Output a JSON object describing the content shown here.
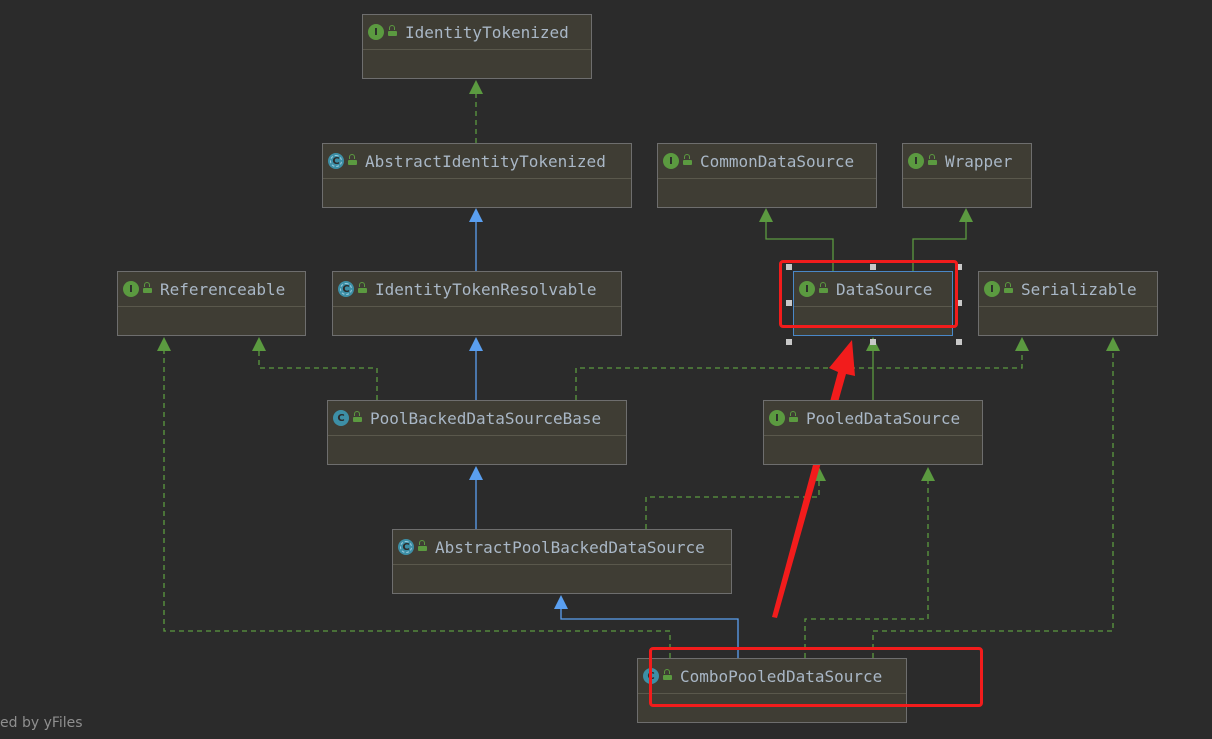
{
  "nodes": {
    "identity_tokenized": {
      "name": "IdentityTokenized",
      "kind": "interface"
    },
    "abstract_identity_tokenized": {
      "name": "AbstractIdentityTokenized",
      "kind": "abstract"
    },
    "common_data_source": {
      "name": "CommonDataSource",
      "kind": "interface"
    },
    "wrapper": {
      "name": "Wrapper",
      "kind": "interface"
    },
    "referenceable": {
      "name": "Referenceable",
      "kind": "interface"
    },
    "identity_token_resolvable": {
      "name": "IdentityTokenResolvable",
      "kind": "abstract"
    },
    "data_source": {
      "name": "DataSource",
      "kind": "interface"
    },
    "serializable": {
      "name": "Serializable",
      "kind": "interface"
    },
    "pool_backed_data_source_base": {
      "name": "PoolBackedDataSourceBase",
      "kind": "class"
    },
    "pooled_data_source": {
      "name": "PooledDataSource",
      "kind": "interface"
    },
    "abstract_pool_backed_data_source": {
      "name": "AbstractPoolBackedDataSource",
      "kind": "abstract"
    },
    "combo_pooled_data_source": {
      "name": "ComboPooledDataSource",
      "kind": "class"
    }
  },
  "kind_letters": {
    "interface": "I",
    "class": "C",
    "abstract": "C"
  },
  "edge_colors": {
    "extends": "#5a9ff0",
    "implements": "#5b9a40",
    "highlight": "#f21c1c"
  },
  "footer": "ed by yFiles"
}
